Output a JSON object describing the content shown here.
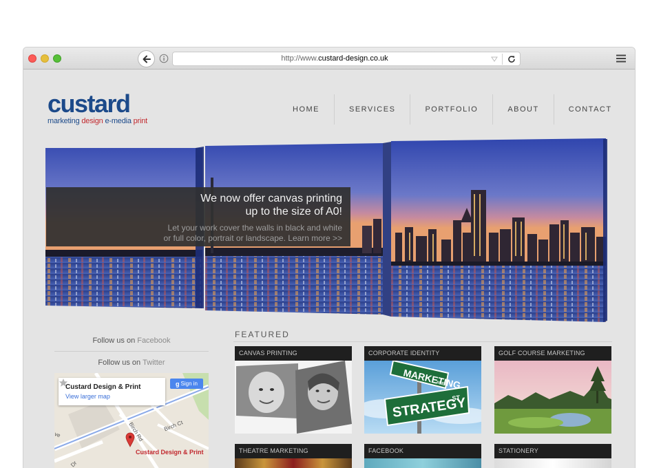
{
  "browser": {
    "url_prefix": "http://www.",
    "url_domain": "custard-design.co.uk"
  },
  "logo": {
    "word": "custard",
    "tag_1": "marketing",
    "tag_2": "design",
    "tag_3": "e-media",
    "tag_4": "print"
  },
  "nav": [
    "HOME",
    "SERVICES",
    "PORTFOLIO",
    "ABOUT",
    "CONTACT"
  ],
  "hero": {
    "headline_1": "We now offer canvas printing",
    "headline_2": "up to the size of A0!",
    "body_1": "Let your work cover the walls in black and white",
    "body_2": "or full color, portrait or landscape. Learn more >>"
  },
  "social": {
    "follow_prefix": "Follow us on",
    "facebook": "Facebook",
    "twitter": "Twitter"
  },
  "map": {
    "business_name": "Custard Design & Print",
    "view_larger": "View larger map",
    "sign_in": "Sign in",
    "g_letter": "g",
    "pin_label": "Custard Design & Print",
    "street_birch_rd": "Birch Rd",
    "street_birch_ct": "Birch Ct",
    "street_ave": "ve",
    "street_dr": "Dr"
  },
  "featured": {
    "heading": "FEATURED",
    "tiles": [
      {
        "label": "CANVAS PRINTING"
      },
      {
        "label": "CORPORATE IDENTITY",
        "sign_1": "MARKETING",
        "sign_2": "STRATEGY",
        "sign_ave": "AVE",
        "sign_st": "ST"
      },
      {
        "label": "GOLF COURSE MARKETING"
      },
      {
        "label": "THEATRE MARKETING"
      },
      {
        "label": "FACEBOOK"
      },
      {
        "label": "STATIONERY"
      }
    ]
  },
  "colors": {
    "brand_blue": "#1c4a8a",
    "brand_red": "#c22a2f",
    "page_bg": "#e4e4e4",
    "tile_label_bg": "#1f1f1f",
    "map_link": "#3a6fd8"
  }
}
